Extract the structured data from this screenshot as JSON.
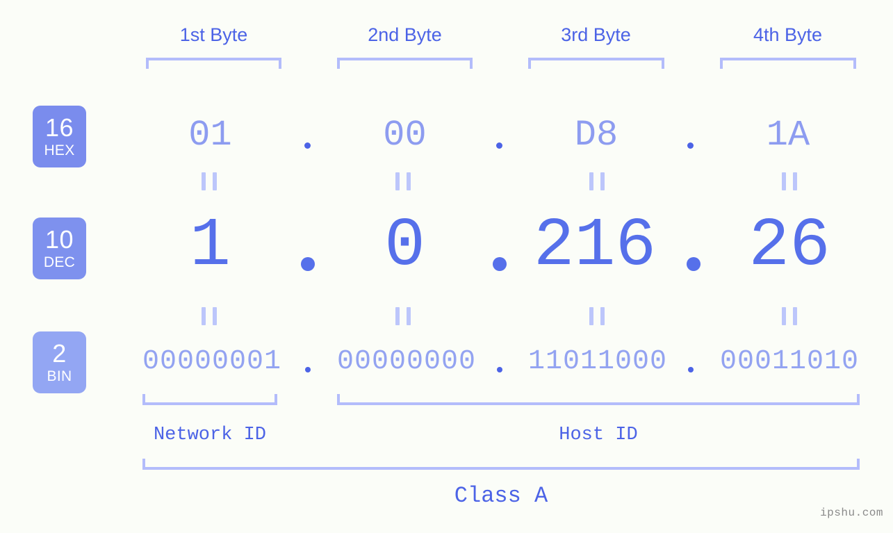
{
  "page": {
    "background_color": "#fbfdf8",
    "accent_color": "#4c63e6",
    "bracket_color": "#b3bcfb"
  },
  "byte_headers": [
    {
      "label": "1st Byte"
    },
    {
      "label": "2nd Byte"
    },
    {
      "label": "3rd Byte"
    },
    {
      "label": "4th Byte"
    }
  ],
  "bases": [
    {
      "number": "16",
      "abbr": "HEX",
      "badge_color": "#7a8ced"
    },
    {
      "number": "10",
      "abbr": "DEC",
      "badge_color": "#7e91ee"
    },
    {
      "number": "2",
      "abbr": "BIN",
      "badge_color": "#93a6f3"
    }
  ],
  "rows": {
    "hex": {
      "values": [
        "01",
        "00",
        "D8",
        "1A"
      ],
      "separator": ".",
      "text_color": "#8d9cf0"
    },
    "dec": {
      "values": [
        "1",
        "0",
        "216",
        "26"
      ],
      "separator": ".",
      "text_color": "#5670ea"
    },
    "bin": {
      "values": [
        "00000001",
        "00000000",
        "11011000",
        "00011010"
      ],
      "separator": ".",
      "text_color": "#93a3f1"
    }
  },
  "equals_connectors": {
    "glyph": "=",
    "count_per_row": 4,
    "color": "#bcc6fb"
  },
  "id_regions": [
    {
      "label": "Network ID"
    },
    {
      "label": "Host ID"
    }
  ],
  "class": {
    "label": "Class A"
  },
  "watermark": {
    "text": "ipshu.com"
  }
}
